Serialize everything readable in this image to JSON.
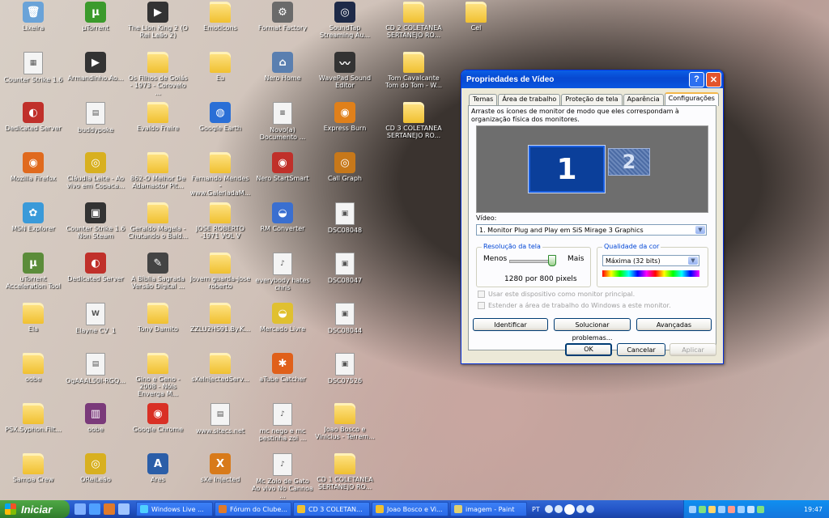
{
  "desktop": {
    "icons": [
      {
        "label": "Lixeira",
        "type": "app",
        "glyph": "🗑",
        "color": "#6aa3d8"
      },
      {
        "label": "Counter Strike 1.6",
        "type": "file",
        "glyph": "▦",
        "color": ""
      },
      {
        "label": "Dedicated Server",
        "type": "app",
        "glyph": "◐",
        "color": "#c0302a"
      },
      {
        "label": "Mozilla Firefox",
        "type": "app",
        "glyph": "◉",
        "color": "#e06a1e"
      },
      {
        "label": "MSN Explorer",
        "type": "app",
        "glyph": "✿",
        "color": "#3a9ad9"
      },
      {
        "label": "uTorrent Acceleration Tool",
        "type": "app",
        "glyph": "μ",
        "color": "#5b8c3a"
      },
      {
        "label": "Ela",
        "type": "folder",
        "glyph": "",
        "color": ""
      },
      {
        "label": "oobe",
        "type": "folder",
        "glyph": "",
        "color": ""
      },
      {
        "label": "PSX.Syphon.Filt...",
        "type": "folder",
        "glyph": "",
        "color": ""
      },
      {
        "label": "Sampa Crew",
        "type": "folder",
        "glyph": "",
        "color": ""
      },
      {
        "label": "µTorrent",
        "type": "app",
        "glyph": "μ",
        "color": "#3b9a2c"
      },
      {
        "label": "Armandinho.Ao...",
        "type": "app",
        "glyph": "▶",
        "color": "#333333"
      },
      {
        "label": "buddypoke",
        "type": "file",
        "glyph": "▤",
        "color": ""
      },
      {
        "label": "Cláudia Leite - Ao vivo em Copaca...",
        "type": "app",
        "glyph": "◎",
        "color": "#d8b020"
      },
      {
        "label": "Counter Strike 1.6 Non Steam",
        "type": "app",
        "glyph": "▣",
        "color": "#333333"
      },
      {
        "label": "Dedicated Server",
        "type": "app",
        "glyph": "◐",
        "color": "#c0302a"
      },
      {
        "label": "Elayne CV_1",
        "type": "file",
        "glyph": "W",
        "color": ""
      },
      {
        "label": "OgAAAL50I-RGQ...",
        "type": "file",
        "glyph": "▤",
        "color": ""
      },
      {
        "label": "oobe",
        "type": "app",
        "glyph": "▥",
        "color": "#7a3a7a"
      },
      {
        "label": "OReiLeão",
        "type": "app",
        "glyph": "◎",
        "color": "#d8b020"
      },
      {
        "label": "The Lion King 2 (O Rei Leão 2)",
        "type": "app",
        "glyph": "▶",
        "color": "#333333"
      },
      {
        "label": "Os Filhos de Goiás - 1973 - Corovelo ...",
        "type": "folder",
        "glyph": "",
        "color": ""
      },
      {
        "label": "Evaldo Freire",
        "type": "folder",
        "glyph": "",
        "color": ""
      },
      {
        "label": "862-O Melhor De Adamastor Pit...",
        "type": "folder",
        "glyph": "",
        "color": ""
      },
      {
        "label": "Geraldo Magela - Chutando o Bald...",
        "type": "folder",
        "glyph": "",
        "color": ""
      },
      {
        "label": "A Bíblia Sagrada Versão Digital ...",
        "type": "app",
        "glyph": "✎",
        "color": "#444444"
      },
      {
        "label": "Tony Damito",
        "type": "folder",
        "glyph": "",
        "color": ""
      },
      {
        "label": "Gino e Geno - 2008 - Nóis Enverga M...",
        "type": "folder",
        "glyph": "",
        "color": ""
      },
      {
        "label": "Google Chrome",
        "type": "app",
        "glyph": "◉",
        "color": "#d93025"
      },
      {
        "label": "Ares",
        "type": "app",
        "glyph": "A",
        "color": "#2b5ea8"
      },
      {
        "label": "Emoticons",
        "type": "folder",
        "glyph": "",
        "color": ""
      },
      {
        "label": "Eu",
        "type": "folder",
        "glyph": "",
        "color": ""
      },
      {
        "label": "Google Earth",
        "type": "app",
        "glyph": "◍",
        "color": "#2a6fd6"
      },
      {
        "label": "Fernando Mendes - www.GaleriadaM...",
        "type": "folder",
        "glyph": "",
        "color": ""
      },
      {
        "label": "JOSE ROBERTO -1971 VOL V",
        "type": "folder",
        "glyph": "",
        "color": ""
      },
      {
        "label": "Jovem guarda-jose roberto",
        "type": "folder",
        "glyph": "",
        "color": ""
      },
      {
        "label": "ZZLU2HS91.By.K...",
        "type": "folder",
        "glyph": "",
        "color": ""
      },
      {
        "label": "sXeInjectedServ...",
        "type": "folder",
        "glyph": "",
        "color": ""
      },
      {
        "label": "www.sitecs.net",
        "type": "file",
        "glyph": "▤",
        "color": ""
      },
      {
        "label": "sXe Injected",
        "type": "app",
        "glyph": "X",
        "color": "#d87a1a"
      },
      {
        "label": "Format Factory",
        "type": "app",
        "glyph": "⚙",
        "color": "#6a6a6a"
      },
      {
        "label": "Nero Home",
        "type": "app",
        "glyph": "⌂",
        "color": "#5a7fb0"
      },
      {
        "label": "Novo(a) Documento ...",
        "type": "file",
        "glyph": "≡",
        "color": ""
      },
      {
        "label": "Nero StartSmart",
        "type": "app",
        "glyph": "◉",
        "color": "#c0302a"
      },
      {
        "label": "RM Converter",
        "type": "app",
        "glyph": "◒",
        "color": "#3a6fd0"
      },
      {
        "label": "everybody hates chris",
        "type": "file",
        "glyph": "♪",
        "color": ""
      },
      {
        "label": "Mercado Livre",
        "type": "app",
        "glyph": "◒",
        "color": "#e0c030"
      },
      {
        "label": "aTube Catcher",
        "type": "app",
        "glyph": "✱",
        "color": "#e0601a"
      },
      {
        "label": "mc nego e mc pestinha zoi ...",
        "type": "file",
        "glyph": "♪",
        "color": ""
      },
      {
        "label": "Mc Zoio de Gato Ao vivo No Cannoa ...",
        "type": "file",
        "glyph": "♪",
        "color": ""
      },
      {
        "label": "SoundTap Streaming Au...",
        "type": "app",
        "glyph": "◎",
        "color": "#1e2a48"
      },
      {
        "label": "WavePad Sound Editor",
        "type": "app",
        "glyph": "〰",
        "color": "#333333"
      },
      {
        "label": "Express Burn",
        "type": "app",
        "glyph": "◉",
        "color": "#e0801a"
      },
      {
        "label": "Call Graph",
        "type": "app",
        "glyph": "◎",
        "color": "#c7781a"
      },
      {
        "label": "DSC08048",
        "type": "file",
        "glyph": "▣",
        "color": ""
      },
      {
        "label": "DSC08047",
        "type": "file",
        "glyph": "▣",
        "color": ""
      },
      {
        "label": "DSC08044",
        "type": "file",
        "glyph": "▣",
        "color": ""
      },
      {
        "label": "DSC07526",
        "type": "file",
        "glyph": "▣",
        "color": ""
      },
      {
        "label": "Joao Bosco e Vinicius - Terrem...",
        "type": "folder",
        "glyph": "",
        "color": ""
      },
      {
        "label": "CD 1 COLETANEA SERTANEJO RO...",
        "type": "folder",
        "glyph": "",
        "color": ""
      },
      {
        "label": "CD 2 COLETANEA SERTANEJO RO...",
        "type": "folder",
        "glyph": "",
        "color": ""
      },
      {
        "label": "Tom Cavalcante Tom do Tom - W...",
        "type": "folder",
        "glyph": "",
        "color": ""
      },
      {
        "label": "CD 3 COLETANEA SERTANEJO RO...",
        "type": "folder",
        "glyph": "",
        "color": ""
      },
      {
        "label": "Cel",
        "type": "folder",
        "glyph": "",
        "color": ""
      }
    ]
  },
  "dialog": {
    "title": "Propriedades de Vídeo",
    "help_glyph": "?",
    "close_glyph": "✕",
    "tabs": [
      "Temas",
      "Área de trabalho",
      "Proteção de tela",
      "Aparência",
      "Configurações"
    ],
    "active_tab": "Configurações",
    "hint": "Arraste os ícones de monitor de modo que eles correspondam à organização física dos monitores.",
    "monitor1": "1",
    "monitor2": "2",
    "video_label": "Vídeo:",
    "video_value": "1. Monitor Plug and Play em SiS Mirage 3 Graphics",
    "resolution_group": "Resolução da tela",
    "less_label": "Menos",
    "more_label": "Mais",
    "resolution_value": "1280 por 800 pixels",
    "color_group": "Qualidade da cor",
    "color_value": "Máxima (32 bits)",
    "primary_checkbox": "Usar este dispositivo como monitor principal.",
    "extend_checkbox": "Estender a área de trabalho do Windows a este monitor.",
    "identify_button": "Identificar",
    "troubleshoot_button": "Solucionar problemas...",
    "advanced_button": "Avançadas",
    "ok_button": "OK",
    "cancel_button": "Cancelar",
    "apply_button": "Aplicar"
  },
  "taskbar": {
    "start_label": "Iniciar",
    "tasks": [
      "Windows Live ...",
      "Fórum do Clube...",
      "CD 3 COLETAN...",
      "Joao Bosco e Vi...",
      "imagem - Paint"
    ],
    "language": "PT",
    "clock": "19:47"
  }
}
